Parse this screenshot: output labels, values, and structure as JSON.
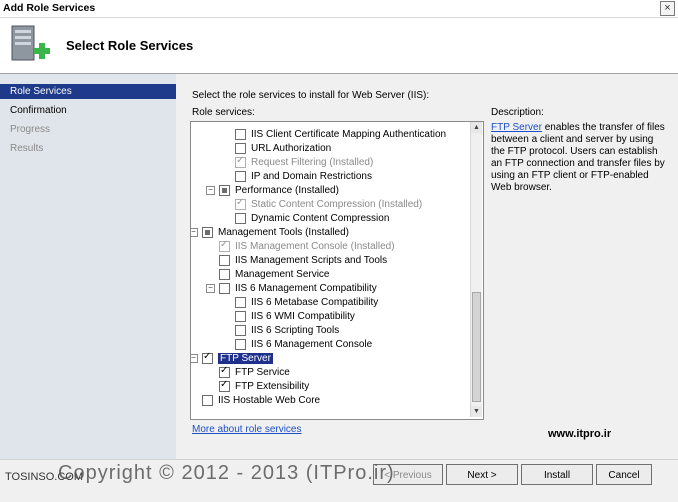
{
  "window": {
    "title": "Add Role Services",
    "close_glyph": "×"
  },
  "header": {
    "title": "Select Role Services",
    "icon": "server-add-icon"
  },
  "sidebar": {
    "items": [
      {
        "label": "Role Services",
        "state": "active"
      },
      {
        "label": "Confirmation",
        "state": "normal"
      },
      {
        "label": "Progress",
        "state": "disabled"
      },
      {
        "label": "Results",
        "state": "disabled"
      }
    ]
  },
  "main": {
    "instruction": "Select the role services to install for Web Server (IIS):",
    "role_services_label": "Role services:",
    "tree": [
      {
        "label": "IIS Client Certificate Mapping Authentication",
        "indent": 2,
        "check": "unchecked",
        "installed": false
      },
      {
        "label": "URL Authorization",
        "indent": 2,
        "check": "unchecked",
        "installed": false
      },
      {
        "label": "Request Filtering  (Installed)",
        "indent": 2,
        "check": "checked-gray",
        "installed": true
      },
      {
        "label": "IP and Domain Restrictions",
        "indent": 2,
        "check": "unchecked",
        "installed": false
      },
      {
        "label": "Performance  (Installed)",
        "indent": 1,
        "check": "partial",
        "installed": false,
        "expander": "−"
      },
      {
        "label": "Static Content Compression  (Installed)",
        "indent": 2,
        "check": "checked-gray",
        "installed": true
      },
      {
        "label": "Dynamic Content Compression",
        "indent": 2,
        "check": "unchecked",
        "installed": false
      },
      {
        "label": "Management Tools  (Installed)",
        "indent": 0,
        "check": "partial",
        "installed": false,
        "expander": "−"
      },
      {
        "label": "IIS Management Console  (Installed)",
        "indent": 1,
        "check": "checked-gray",
        "installed": true
      },
      {
        "label": "IIS Management Scripts and Tools",
        "indent": 1,
        "check": "unchecked",
        "installed": false
      },
      {
        "label": "Management Service",
        "indent": 1,
        "check": "unchecked",
        "installed": false
      },
      {
        "label": "IIS 6 Management Compatibility",
        "indent": 1,
        "check": "unchecked",
        "installed": false,
        "expander": "−"
      },
      {
        "label": "IIS 6 Metabase Compatibility",
        "indent": 2,
        "check": "unchecked",
        "installed": false
      },
      {
        "label": "IIS 6 WMI Compatibility",
        "indent": 2,
        "check": "unchecked",
        "installed": false
      },
      {
        "label": "IIS 6 Scripting Tools",
        "indent": 2,
        "check": "unchecked",
        "installed": false
      },
      {
        "label": "IIS 6 Management Console",
        "indent": 2,
        "check": "unchecked",
        "installed": false
      },
      {
        "label": "FTP Server",
        "indent": 0,
        "check": "checked",
        "installed": false,
        "expander": "−",
        "selected": true
      },
      {
        "label": "FTP Service",
        "indent": 1,
        "check": "checked",
        "installed": false
      },
      {
        "label": "FTP Extensibility",
        "indent": 1,
        "check": "checked",
        "installed": false
      },
      {
        "label": "IIS Hostable Web Core",
        "indent": 0,
        "check": "unchecked",
        "installed": false
      }
    ],
    "description_label": "Description:",
    "description_link": "FTP Server",
    "description_text": " enables the transfer of files between a client and server by using the FTP protocol. Users can establish an FTP connection and transfer files by using an FTP client or FTP-enabled Web browser.",
    "more_link": "More about role services",
    "site_text": "www.itpro.ir"
  },
  "footer": {
    "previous": "< Previous",
    "next": "Next >",
    "install": "Install",
    "cancel": "Cancel",
    "watermark": "TOSINSO.COM",
    "copyright": "Copyright © 2012 - 2013 (ITPro.ir)"
  },
  "colors": {
    "selection": "#1f2f8c",
    "sidebar_active": "#1e3a8a",
    "link": "#1d4fc7",
    "sidebar_bg": "#dfe5ea"
  }
}
